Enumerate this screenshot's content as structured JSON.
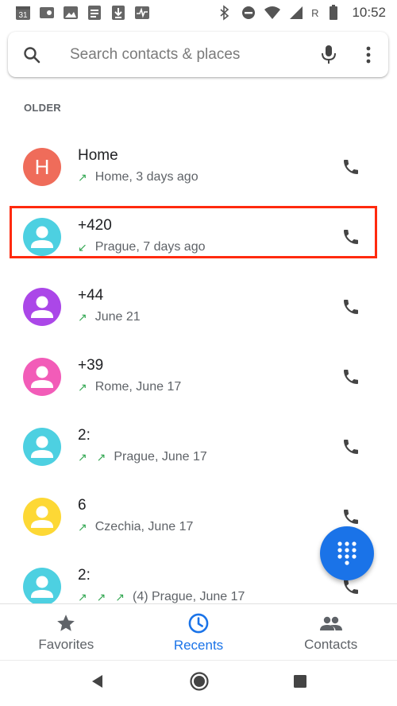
{
  "status_bar": {
    "time": "10:52",
    "calendar_day": "31",
    "network_label": "R"
  },
  "search": {
    "placeholder": "Search contacts & places"
  },
  "section": {
    "header": "OLDER"
  },
  "calls": [
    {
      "name": "Home",
      "avatar_letter": "H",
      "avatar_color": "#ef6c5a",
      "direction": "outgoing",
      "arrows": "↗",
      "detail": "Home, 3 days ago"
    },
    {
      "name": "+420",
      "avatar_letter": "",
      "avatar_color": "#4dd0e1",
      "direction": "incoming",
      "arrows": "↙",
      "detail": "Prague, 7 days ago"
    },
    {
      "name": "+44",
      "avatar_letter": "",
      "avatar_color": "#ab47e8",
      "direction": "outgoing",
      "arrows": "↗",
      "detail": "June 21"
    },
    {
      "name": "+39",
      "avatar_letter": "",
      "avatar_color": "#f25cb8",
      "direction": "outgoing",
      "arrows": "↗",
      "detail": "Rome, June 17"
    },
    {
      "name": "2:",
      "avatar_letter": "",
      "avatar_color": "#4dd0e1",
      "direction": "outgoing",
      "arrows": "↗ ↗",
      "detail": "Prague, June 17"
    },
    {
      "name": "6",
      "avatar_letter": "",
      "avatar_color": "#fdd835",
      "direction": "outgoing",
      "arrows": "↗",
      "detail": "Czechia, June 17"
    },
    {
      "name": "2:",
      "avatar_letter": "",
      "avatar_color": "#4dd0e1",
      "direction": "outgoing",
      "arrows": "↗ ↗ ↗",
      "detail": "(4) Prague, June 17"
    }
  ],
  "bottom_nav": {
    "tabs": [
      {
        "label": "Favorites",
        "icon": "star-icon",
        "active": false
      },
      {
        "label": "Recents",
        "icon": "clock-icon",
        "active": true
      },
      {
        "label": "Contacts",
        "icon": "people-icon",
        "active": false
      }
    ]
  },
  "colors": {
    "accent": "#1a73e8",
    "call_arrow": "#34a853",
    "highlight": "#ff2a0e"
  }
}
